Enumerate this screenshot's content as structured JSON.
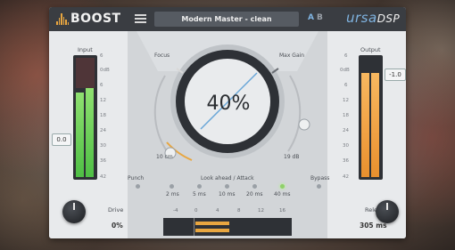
{
  "header": {
    "logo_text": "BOOST",
    "preset_name": "Modern Master - clean",
    "ab_a": "A",
    "ab_b": "B",
    "brand_main": "ursa",
    "brand_suffix": "DSP"
  },
  "input": {
    "label": "Input",
    "scale": [
      "6",
      "0dB",
      "6",
      "12",
      "18",
      "24",
      "30",
      "36",
      "42"
    ],
    "value": "0.0"
  },
  "output": {
    "label": "Output",
    "scale": [
      "6",
      "0dB",
      "6",
      "12",
      "18",
      "24",
      "30",
      "36",
      "42"
    ],
    "value": "-1.0"
  },
  "focus": {
    "label": "Focus",
    "value": "10 cm"
  },
  "maxgain": {
    "label": "Max Gain",
    "value": "19 dB"
  },
  "main_dial": {
    "value": "40%"
  },
  "punch": {
    "label": "Punch"
  },
  "bypass": {
    "label": "Bypass"
  },
  "lookahead": {
    "label": "Look ahead / Attack",
    "options": [
      "2 ms",
      "5 ms",
      "10 ms",
      "20 ms",
      "40 ms"
    ],
    "selected": "40 ms"
  },
  "drive": {
    "label": "Drive",
    "value": "0%"
  },
  "release": {
    "label": "Release",
    "value": "305 ms"
  },
  "gr_scale": [
    "-4",
    "0",
    "4",
    "8",
    "12",
    "16"
  ],
  "colors": {
    "accent": "#e8a640",
    "input_meter": "#6fd65a",
    "output_meter": "#f0a040",
    "dial_line": "#6aa7d8"
  }
}
